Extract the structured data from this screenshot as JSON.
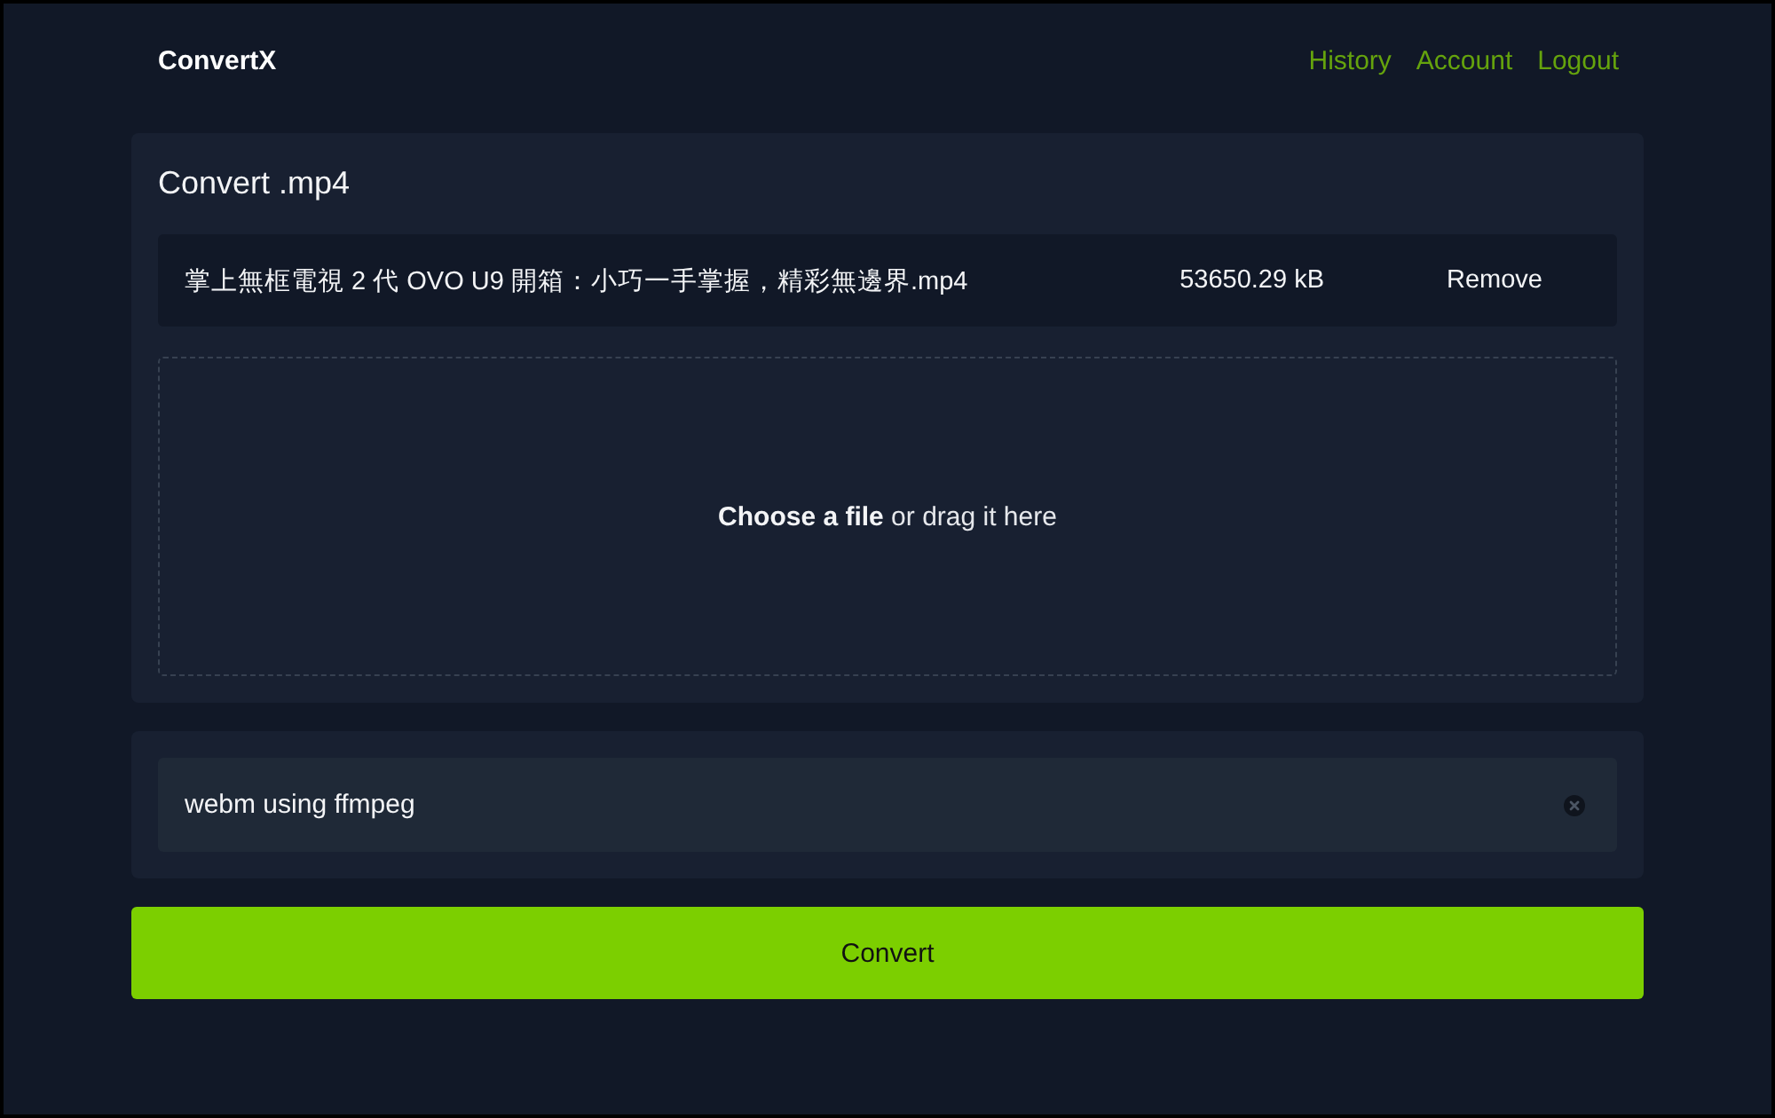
{
  "header": {
    "logo": "ConvertX",
    "nav": [
      {
        "label": "History"
      },
      {
        "label": "Account"
      },
      {
        "label": "Logout"
      }
    ]
  },
  "convert_panel": {
    "title": "Convert .mp4",
    "files": [
      {
        "name": "掌上無框電視 2 代 OVO U9 開箱：小巧一手掌握，精彩無邊界.mp4",
        "size": "53650.29 kB",
        "action": "Remove"
      }
    ],
    "dropzone": {
      "text": "**Choose a file** or drag it here"
    }
  },
  "target_panel": {
    "converter": {
      "value": "webm using ffmpeg"
    }
  },
  "convert_button": {
    "label": "Convert"
  }
}
